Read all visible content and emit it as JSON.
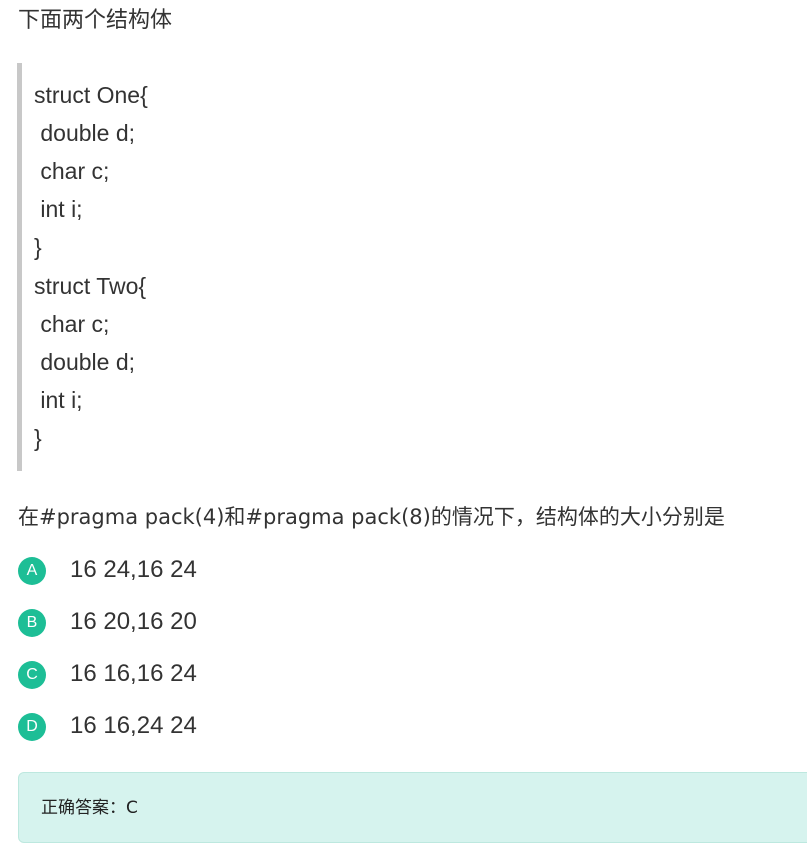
{
  "intro": "下面两个结构体",
  "code_lines": [
    "struct One{",
    " double d;",
    " char c;",
    " int i;",
    "}",
    "struct Two{",
    " char c;",
    " double d;",
    " int i;",
    "}"
  ],
  "question": "在#pragma pack(4)和#pragma pack(8)的情况下，结构体的大小分别是",
  "options": [
    {
      "letter": "A",
      "text": "16 24,16 24"
    },
    {
      "letter": "B",
      "text": "16 20,16 20"
    },
    {
      "letter": "C",
      "text": "16 16,16 24"
    },
    {
      "letter": "D",
      "text": "16 16,24 24"
    }
  ],
  "answer": "正确答案：C",
  "colors": {
    "badge": "#1dbe96",
    "answer_background": "#d6f3ee",
    "code_border": "#c8c8c8"
  }
}
